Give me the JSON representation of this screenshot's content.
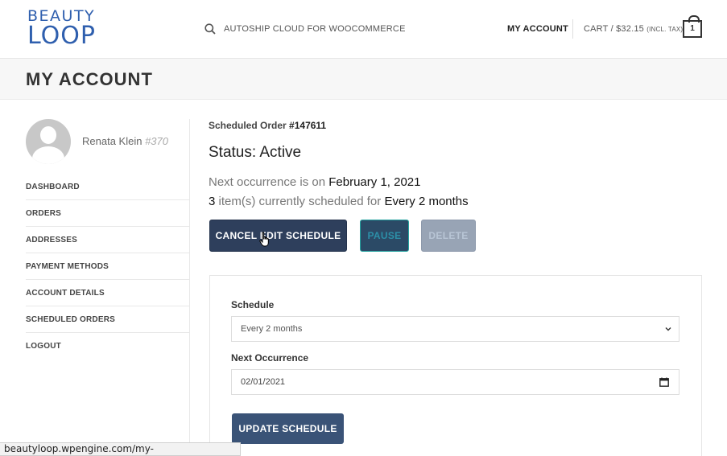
{
  "header": {
    "logo_line1": "BEAUTY",
    "logo_line2": "LOOP",
    "search_text": "AUTOSHIP CLOUD FOR WOOCOMMERCE",
    "my_account": "MY ACCOUNT",
    "cart_label": "CART / $32.15",
    "cart_tax": "(INCL. TAX)",
    "cart_count": "1",
    "brand_color": "#2f5fae"
  },
  "page": {
    "title": "MY ACCOUNT"
  },
  "user": {
    "name": "Renata Klein",
    "id": "#370"
  },
  "sidebar": {
    "items": [
      {
        "label": "DASHBOARD"
      },
      {
        "label": "ORDERS"
      },
      {
        "label": "ADDRESSES"
      },
      {
        "label": "PAYMENT METHODS"
      },
      {
        "label": "ACCOUNT DETAILS"
      },
      {
        "label": "SCHEDULED ORDERS"
      },
      {
        "label": "LOGOUT"
      }
    ]
  },
  "order": {
    "label": "Scheduled Order",
    "number": "#147611",
    "status": "Status: Active",
    "next_prefix": "Next occurrence is on",
    "next_date": "February 1, 2021",
    "item_count": "3",
    "items_text": "item(s) currently scheduled for",
    "frequency": "Every 2 months"
  },
  "buttons": {
    "cancel": "CANCEL EDIT SCHEDULE",
    "pause": "PAUSE",
    "delete": "DELETE",
    "update": "UPDATE SCHEDULE"
  },
  "form": {
    "schedule_label": "Schedule",
    "schedule_value": "Every 2 months",
    "next_label": "Next Occurrence",
    "next_value": "02/01/2021"
  },
  "statusbar": {
    "url": "beautyloop.wpengine.com/my-account/.../147611/"
  }
}
